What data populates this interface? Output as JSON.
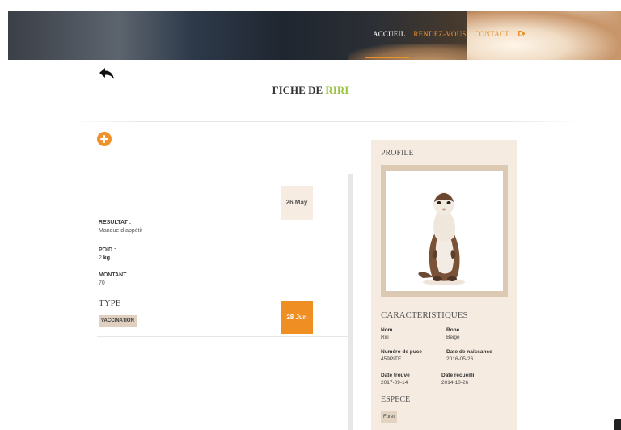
{
  "header": {
    "nav": [
      {
        "label": "ACCUEIL"
      },
      {
        "label": "RENDEZ-VOUS"
      },
      {
        "label": "CONTACT"
      }
    ]
  },
  "page": {
    "title_prefix": "FICHE DE",
    "title_name": "RIRI"
  },
  "timeline": {
    "entries": [
      {
        "date": "26 May",
        "resultat_label": "RESULTAT :",
        "resultat_value": "Manque d appétit",
        "poid_label": "POID :",
        "poid_value": "2",
        "poid_unit": "kg",
        "montant_label": "MONTANT :",
        "montant_value": "70",
        "type_heading": "TYPE",
        "type_value": "VACCINATION"
      },
      {
        "date": "28 Jun"
      }
    ]
  },
  "profile": {
    "heading": "PROFILE",
    "caracteristiques_heading": "CARACTERISTIQUES",
    "nom_label": "Nom",
    "nom_value": "Riri",
    "robe_label": "Robe",
    "robe_value": "Beige",
    "puce_label": "Numéro de puce",
    "puce_value": "459PITE",
    "naissance_label": "Date de naissance",
    "naissance_value": "2016-05-26",
    "trouve_label": "Date trouvé",
    "trouve_value": "2017-09-14",
    "recueilli_label": "Date recueilli",
    "recueilli_value": "2014-10-26",
    "espece_heading": "ESPECE",
    "espece_value": "Furet"
  },
  "colors": {
    "accent": "#ef8f23",
    "name_green": "#9ac43c",
    "panel_bg": "#f6ebe0"
  }
}
